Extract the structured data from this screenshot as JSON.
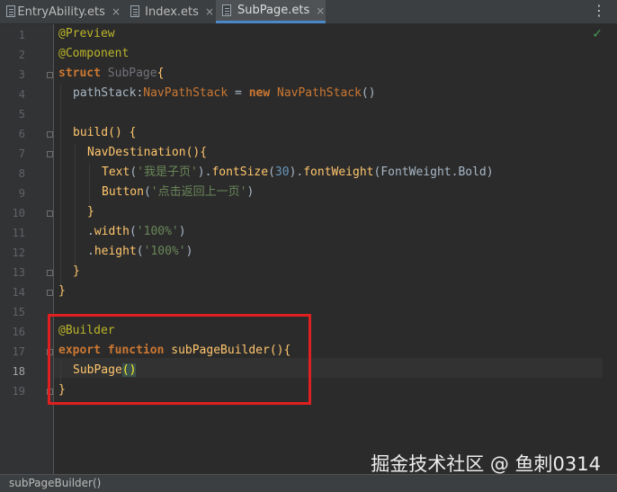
{
  "tabs": [
    {
      "label": "EntryAbility.ets",
      "close": "×"
    },
    {
      "label": "Index.ets",
      "close": "×"
    },
    {
      "label": "SubPage.ets",
      "close": "×"
    }
  ],
  "menu_icon": "⋮",
  "inspection_icon": "✓",
  "line_numbers": [
    "1",
    "2",
    "3",
    "4",
    "5",
    "6",
    "7",
    "8",
    "9",
    "10",
    "11",
    "12",
    "13",
    "14",
    "15",
    "16",
    "17",
    "18",
    "19"
  ],
  "code": {
    "l1_ann": "@Preview",
    "l2_ann": "@Component",
    "l3_kw": "struct",
    "l3_name": "SubPage",
    "l3_brace": "{",
    "l4_field": "pathStack",
    "l4_colon": ":",
    "l4_type": "NavPathStack",
    "l4_eq": " = ",
    "l4_new": "new",
    "l4_ctor": "NavPathStack",
    "l4_paren": "()",
    "l6_build": "build",
    "l6_rest": "() {",
    "l7_nav": "NavDestination",
    "l7_rest": "(){",
    "l8_text": "Text",
    "l8_open": "(",
    "l8_str": "'我是子页'",
    "l8_mid1": ").",
    "l8_fs": "fontSize",
    "l8_mid2": "(",
    "l8_num": "30",
    "l8_mid3": ").",
    "l8_fw": "fontWeight",
    "l8_mid4": "(",
    "l8_enum": "FontWeight",
    "l8_dot": ".",
    "l8_bold": "Bold",
    "l8_close": ")",
    "l9_button": "Button",
    "l9_open": "(",
    "l9_str": "'点击返回上一页'",
    "l9_close": ")",
    "l10_brace": "}",
    "l11_dot": ".",
    "l11_width": "width",
    "l11_open": "(",
    "l11_str": "'100%'",
    "l11_close": ")",
    "l12_dot": ".",
    "l12_height": "height",
    "l12_open": "(",
    "l12_str": "'100%'",
    "l12_close": ")",
    "l13_brace": "}",
    "l14_brace": "}",
    "l16_ann": "@Builder",
    "l17_export": "export",
    "l17_function": "function",
    "l17_name": "subPageBuilder",
    "l17_rest": "(){",
    "l18_call": "SubPage",
    "l18_parens": "()",
    "l19_brace": "}"
  },
  "status_bar": {
    "text": "subPageBuilder()"
  },
  "watermark": "掘金技术社区 @ 鱼刺0314",
  "colors": {
    "background": "#2b2b2b",
    "keyword": "#cc7832",
    "annotation": "#bbb529",
    "string": "#6a8759",
    "number": "#6897bb",
    "function": "#ffc66d",
    "highlight_box": "#e02020"
  }
}
